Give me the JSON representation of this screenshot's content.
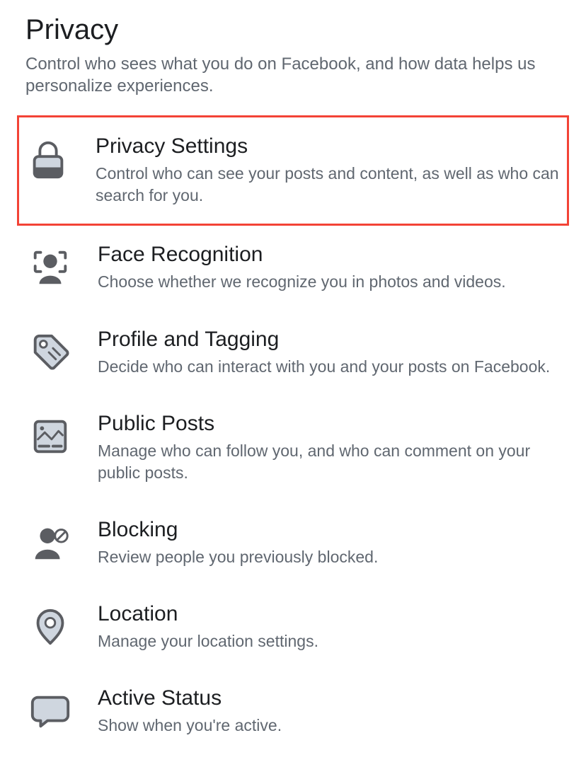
{
  "page": {
    "title": "Privacy",
    "subtitle": "Control who sees what you do on Facebook, and how data helps us personalize experiences."
  },
  "options": [
    {
      "title": "Privacy Settings",
      "desc": "Control who can see your posts and content, as well as who can search for you.",
      "highlighted": true
    },
    {
      "title": "Face Recognition",
      "desc": "Choose whether we recognize you in photos and videos."
    },
    {
      "title": "Profile and Tagging",
      "desc": "Decide who can interact with you and your posts on Facebook."
    },
    {
      "title": "Public Posts",
      "desc": "Manage who can follow you, and who can comment on your public posts."
    },
    {
      "title": "Blocking",
      "desc": "Review people you previously blocked."
    },
    {
      "title": "Location",
      "desc": "Manage your location settings."
    },
    {
      "title": "Active Status",
      "desc": "Show when you're active."
    }
  ]
}
